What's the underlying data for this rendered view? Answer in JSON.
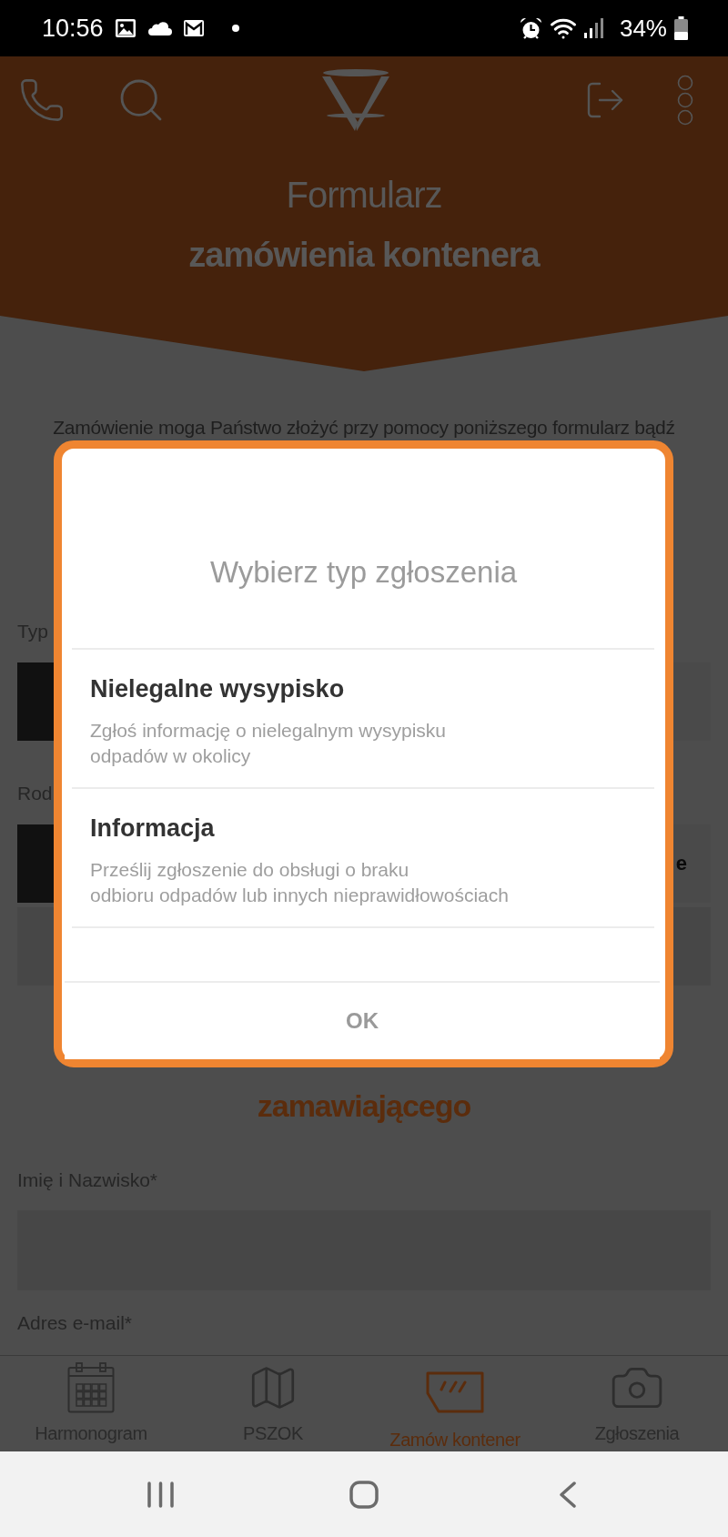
{
  "status_bar": {
    "time": "10:56",
    "battery": "34%"
  },
  "header": {
    "title": [
      "Formularz",
      "zamówienia kontenera"
    ]
  },
  "form": {
    "intro": "Zamówienie moga Państwo złożyć przy pomocy poniższego formularz bądź",
    "fields": [
      {
        "kind": "toggle",
        "label": "Typ",
        "options": [
          {
            "selected": true
          },
          {
            "selected": false
          }
        ]
      },
      {
        "kind": "toggle",
        "label": "Rod",
        "options": [
          {
            "selected": true
          },
          {
            "selected": false,
            "label": "e"
          }
        ]
      },
      {
        "kind": "input"
      },
      {
        "kind": "heading",
        "label": "zamawiającego"
      },
      {
        "kind": "input",
        "label": "Imię i Nazwisko*"
      },
      {
        "kind": "label",
        "label": "Adres e-mail*"
      }
    ]
  },
  "dialog": {
    "title": "Wybierz typ zgłoszenia",
    "options": [
      {
        "title": "Nielegalne wysypisko",
        "description": "Zgłoś informację o nielegalnym wysypisku\nodpadów w okolicy"
      },
      {
        "title": "Informacja",
        "description": "Prześlij zgłoszenie do obsługi o braku\nodbioru odpadów lub innych nieprawidłowościach"
      }
    ],
    "button": "OK"
  },
  "bottom_nav": [
    {
      "label": "Harmonogram",
      "selected": false
    },
    {
      "label": "PSZOK",
      "selected": false
    },
    {
      "label": "Zamów kontener",
      "selected": true
    },
    {
      "label": "Zgłoszenia",
      "selected": false
    }
  ]
}
